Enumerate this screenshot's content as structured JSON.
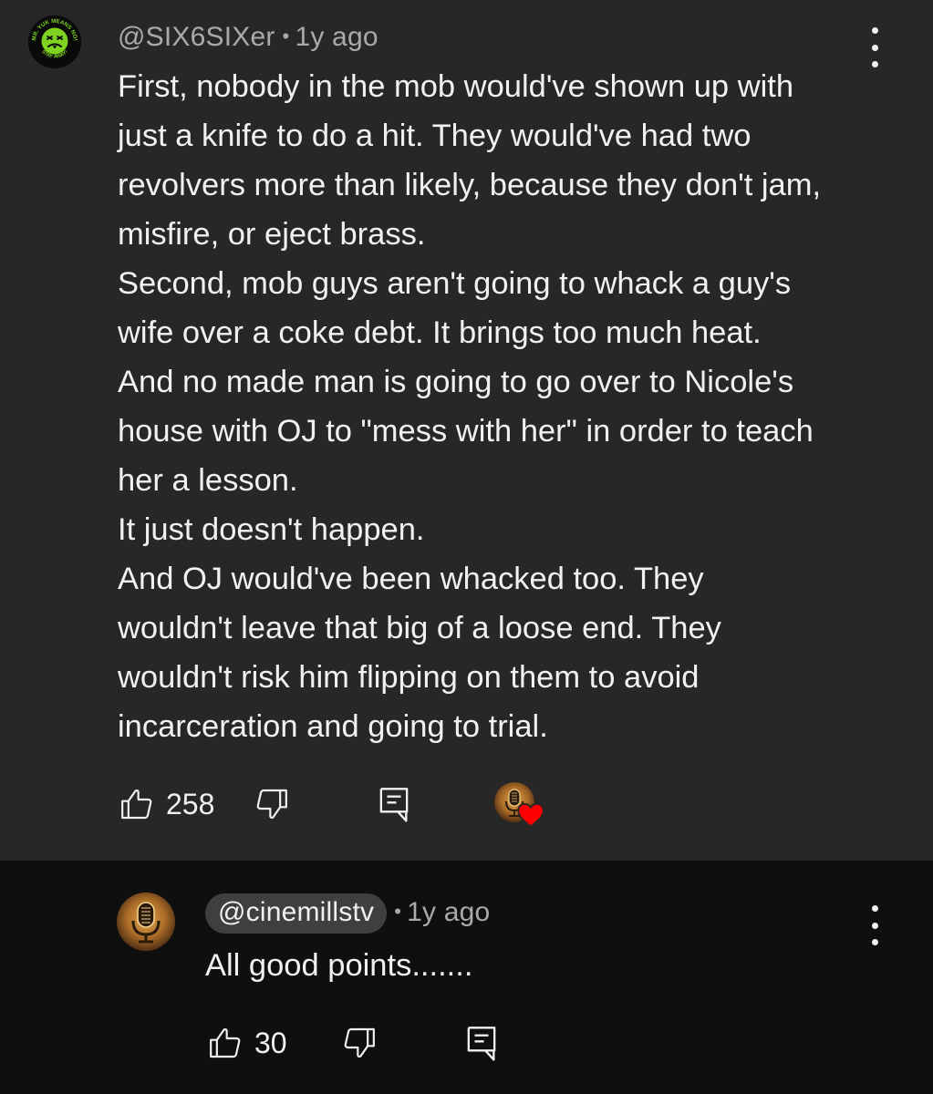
{
  "comment": {
    "author": "@SIX6SIXer",
    "separator": "•",
    "time": "1y ago",
    "avatar_icon": "mr-yuk-icon",
    "avatar_ring_text_top": "MR. YUK MEANS NO!",
    "avatar_ring_text_bottom": "STAY AWAY!",
    "lines": [
      "First, nobody in the mob would've shown up with",
      "just a knife to do a hit. They would've had two",
      "revolvers more than likely, because they don't jam,",
      "misfire, or eject brass.",
      "Second, mob guys aren't going to whack a guy's",
      "wife over a coke debt. It brings too much heat.",
      "And no made man is going to go over to Nicole's",
      "house with OJ to \"mess with her\" in order to teach",
      "her a lesson.",
      "It just doesn't happen.",
      "And OJ would've been whacked too. They",
      "wouldn't leave that big of a loose end. They",
      "wouldn't risk him flipping on them to avoid",
      "incarceration and going to trial."
    ],
    "like_count": "258",
    "icons": {
      "like": "thumbs-up-icon",
      "dislike": "thumbs-down-icon",
      "reply": "reply-icon",
      "menu": "more-vert-icon",
      "creator_heart": "creator-heart-icon"
    }
  },
  "reply": {
    "author": "@cinemillstv",
    "separator": "•",
    "time": "1y ago",
    "avatar_icon": "microphone-icon",
    "text": "All good points.......",
    "like_count": "30"
  },
  "colors": {
    "comment_background": "#272727",
    "reply_background": "#0f0f0f",
    "text_primary": "#f1f1f1",
    "text_secondary": "#aaaaaa",
    "mr_yuk_green": "#7ed321",
    "heart_red": "#ff0000"
  }
}
